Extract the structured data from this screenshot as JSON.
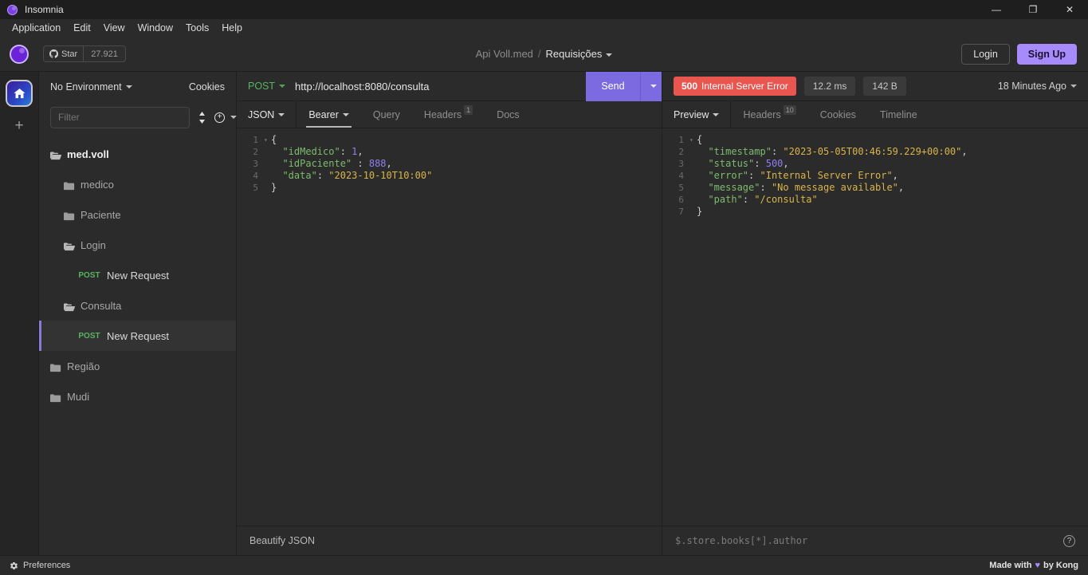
{
  "window": {
    "title": "Insomnia",
    "controls": {
      "minimize": "—",
      "maximize": "❐",
      "close": "✕"
    }
  },
  "menubar": {
    "items": [
      "Application",
      "Edit",
      "View",
      "Window",
      "Tools",
      "Help"
    ]
  },
  "header": {
    "star_label": "Star",
    "star_count": "27.921",
    "workspace": "Api Voll.med",
    "separator": "/",
    "current_doc": "Requisições",
    "login_label": "Login",
    "signup_label": "Sign Up"
  },
  "sidebar": {
    "environment": "No Environment",
    "cookies_label": "Cookies",
    "filter_placeholder": "Filter",
    "filter_value": "",
    "tree": [
      {
        "label": "med.voll",
        "type": "folder-open",
        "indent": 0,
        "method": null,
        "active": false,
        "bold": true
      },
      {
        "label": "medico",
        "type": "folder-closed",
        "indent": 1,
        "method": null,
        "active": false,
        "bold": false
      },
      {
        "label": "Paciente",
        "type": "folder-closed",
        "indent": 1,
        "method": null,
        "active": false,
        "bold": false
      },
      {
        "label": "Login",
        "type": "folder-open",
        "indent": 1,
        "method": null,
        "active": false,
        "bold": false
      },
      {
        "label": "New Request",
        "type": "request",
        "indent": 2,
        "method": "POST",
        "active": false,
        "bold": false
      },
      {
        "label": "Consulta",
        "type": "folder-open",
        "indent": 1,
        "method": null,
        "active": false,
        "bold": false
      },
      {
        "label": "New Request",
        "type": "request",
        "indent": 2,
        "method": "POST",
        "active": true,
        "bold": false
      },
      {
        "label": "Região",
        "type": "folder-closed",
        "indent": 0,
        "method": null,
        "active": false,
        "bold": false
      },
      {
        "label": "Mudi",
        "type": "folder-closed",
        "indent": 0,
        "method": null,
        "active": false,
        "bold": false
      }
    ]
  },
  "request": {
    "method": "POST",
    "url": "http://localhost:8080/consulta",
    "send_label": "Send",
    "tabs": [
      {
        "label": "JSON",
        "dropdown": true,
        "selected": true,
        "badge": null
      },
      {
        "label": "Bearer",
        "dropdown": true,
        "selected": true,
        "badge": null
      },
      {
        "label": "Query",
        "dropdown": false,
        "selected": false,
        "badge": null
      },
      {
        "label": "Headers",
        "dropdown": false,
        "selected": false,
        "badge": "1"
      },
      {
        "label": "Docs",
        "dropdown": false,
        "selected": false,
        "badge": null
      }
    ],
    "body_lines": [
      {
        "n": "1",
        "fold": true,
        "text": "{"
      },
      {
        "n": "2",
        "fold": false,
        "text": "  \"idMedico\": 1,"
      },
      {
        "n": "3",
        "fold": false,
        "text": "  \"idPaciente\" : 888,"
      },
      {
        "n": "4",
        "fold": false,
        "text": "  \"data\": \"2023-10-10T10:00\""
      },
      {
        "n": "5",
        "fold": false,
        "text": "}"
      }
    ],
    "beautify_label": "Beautify JSON"
  },
  "response": {
    "status_code": "500",
    "status_text": "Internal Server Error",
    "time": "12.2 ms",
    "size": "142 B",
    "timestamp_label": "18 Minutes Ago",
    "tabs": [
      {
        "label": "Preview",
        "dropdown": true,
        "selected": true,
        "badge": null
      },
      {
        "label": "Headers",
        "dropdown": false,
        "selected": false,
        "badge": "10"
      },
      {
        "label": "Cookies",
        "dropdown": false,
        "selected": false,
        "badge": null
      },
      {
        "label": "Timeline",
        "dropdown": false,
        "selected": false,
        "badge": null
      }
    ],
    "body_lines": [
      {
        "n": "1",
        "fold": true,
        "text": "{"
      },
      {
        "n": "2",
        "fold": false,
        "text": "  \"timestamp\": \"2023-05-05T00:46:59.229+00:00\","
      },
      {
        "n": "3",
        "fold": false,
        "text": "  \"status\": 500,"
      },
      {
        "n": "4",
        "fold": false,
        "text": "  \"error\": \"Internal Server Error\","
      },
      {
        "n": "5",
        "fold": false,
        "text": "  \"message\": \"No message available\","
      },
      {
        "n": "6",
        "fold": false,
        "text": "  \"path\": \"/consulta\""
      },
      {
        "n": "7",
        "fold": false,
        "text": "}"
      }
    ],
    "filter_placeholder": "$.store.books[*].author",
    "help_glyph": "?"
  },
  "statusbar": {
    "preferences_label": "Preferences",
    "made_with_prefix": "Made with",
    "made_with_suffix": "by Kong"
  },
  "colors": {
    "accent": "#7c6ae0",
    "signup": "#a78bfa",
    "error": "#e8564f",
    "method_post": "#57b560",
    "json_key": "#7dbb6e",
    "json_string": "#d9b44a",
    "json_number": "#8f7ff0",
    "background": "#2b2b2b",
    "titlebar": "#1e1e1e"
  }
}
